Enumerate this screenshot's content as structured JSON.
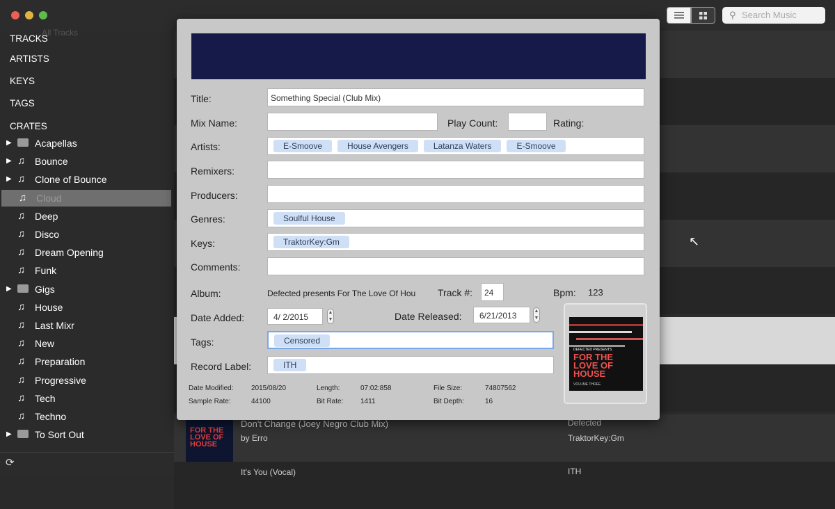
{
  "search": {
    "placeholder": "Search Music"
  },
  "sidebar": {
    "ghost_label": "All Tracks",
    "sections": [
      "TRACKS",
      "ARTISTS",
      "KEYS",
      "TAGS",
      "CRATES"
    ],
    "crates": [
      {
        "label": "Acapellas",
        "icon": "folder-icon",
        "arrow": true
      },
      {
        "label": "Bounce",
        "icon": "music-note-icon",
        "arrow": true
      },
      {
        "label": "Clone of Bounce",
        "icon": "music-note-icon",
        "arrow": true
      },
      {
        "label": "Cloud",
        "icon": "music-note-icon",
        "arrow": false,
        "selected": true
      },
      {
        "label": "Deep",
        "icon": "music-note-icon",
        "arrow": false
      },
      {
        "label": "Disco",
        "icon": "music-note-icon",
        "arrow": false
      },
      {
        "label": "Dream Opening",
        "icon": "music-note-icon",
        "arrow": false
      },
      {
        "label": "Funk",
        "icon": "music-note-icon",
        "arrow": false
      },
      {
        "label": "Gigs",
        "icon": "folder-icon",
        "arrow": true
      },
      {
        "label": "House",
        "icon": "music-note-icon",
        "arrow": false
      },
      {
        "label": "Last Mixr",
        "icon": "music-note-icon",
        "arrow": false
      },
      {
        "label": "New",
        "icon": "music-note-icon",
        "arrow": false
      },
      {
        "label": "Preparation",
        "icon": "music-note-icon",
        "arrow": false
      },
      {
        "label": "Progressive",
        "icon": "music-note-icon",
        "arrow": false
      },
      {
        "label": "Tech",
        "icon": "music-note-icon",
        "arrow": false
      },
      {
        "label": "Techno",
        "icon": "music-note-icon",
        "arrow": false
      },
      {
        "label": "To Sort Out",
        "icon": "folder-icon",
        "arrow": true
      }
    ]
  },
  "tracks": {
    "visible": {
      "title": "Don't Change (Joey Negro Club Mix)",
      "artist": "by Erro",
      "label": "Defected",
      "key": "TraktorKey:Gm",
      "cover_text": "FOR THE LOVE OF HOUSE"
    },
    "next": {
      "title": "It's You (Vocal)",
      "label": "ITH"
    }
  },
  "editor": {
    "labels": {
      "title": "Title:",
      "mix_name": "Mix Name:",
      "play_count": "Play Count:",
      "rating": "Rating:",
      "artists": "Artists:",
      "remixers": "Remixers:",
      "producers": "Producers:",
      "genres": "Genres:",
      "keys": "Keys:",
      "comments": "Comments:",
      "album": "Album:",
      "track_no": "Track #:",
      "bpm": "Bpm:",
      "date_added": "Date Added:",
      "date_released": "Date Released:",
      "tags": "Tags:",
      "record_label": "Record Label:"
    },
    "values": {
      "title": "Something Special (Club Mix)",
      "mix_name": "",
      "play_count": "",
      "artists": [
        "E-Smoove",
        "House Avengers",
        "Latanza Waters",
        "E-Smoove"
      ],
      "remixers": "",
      "producers": "",
      "genres": [
        "Soulful House"
      ],
      "keys": [
        "TraktorKey:Gm"
      ],
      "comments": "",
      "album": "Defected presents For The Love Of Hou",
      "track_no": "24",
      "bpm": "123",
      "date_added": "4/  2/2015",
      "date_released": "6/21/2013",
      "tags": [
        "Censored"
      ],
      "record_label": [
        "ITH"
      ]
    },
    "meta": {
      "date_modified_label": "Date Modified:",
      "date_modified": "2015/08/20",
      "sample_rate_label": "Sample Rate:",
      "sample_rate": "44100",
      "length_label": "Length:",
      "length": "07:02:858",
      "bit_rate_label": "Bit Rate:",
      "bit_rate": "1411",
      "file_size_label": "File Size:",
      "file_size": "74807562",
      "bit_depth_label": "Bit Depth:",
      "bit_depth": "16"
    },
    "cover": {
      "header": "DEFECTED PRESENTS",
      "title": "FOR THE LOVE OF HOUSE",
      "subtitle": "VOLUME THREE"
    },
    "banner_color": "#161a48"
  }
}
